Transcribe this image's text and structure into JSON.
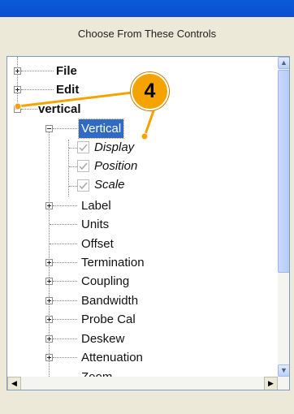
{
  "panel": {
    "title": "Choose From These Controls"
  },
  "tree": {
    "items": [
      {
        "label": "File",
        "expander": "plus",
        "style": "bold"
      },
      {
        "label": "Edit",
        "expander": "plus",
        "style": "bold"
      },
      {
        "label": "vertical",
        "expander": "minus",
        "style": "bold"
      },
      {
        "label": "Vertical",
        "expander": "minus",
        "selected": true
      },
      {
        "label": "Display",
        "checked": true,
        "style": "italic"
      },
      {
        "label": "Position",
        "checked": true,
        "style": "italic"
      },
      {
        "label": "Scale",
        "checked": true,
        "style": "italic"
      },
      {
        "label": "Label",
        "expander": "plus"
      },
      {
        "label": "Units"
      },
      {
        "label": "Offset"
      },
      {
        "label": "Termination",
        "expander": "plus"
      },
      {
        "label": "Coupling",
        "expander": "plus"
      },
      {
        "label": "Bandwidth",
        "expander": "plus"
      },
      {
        "label": "Probe Cal",
        "expander": "plus"
      },
      {
        "label": "Deskew",
        "expander": "plus"
      },
      {
        "label": "Attenuation",
        "expander": "plus"
      },
      {
        "label": "Zoom"
      }
    ]
  },
  "callout": {
    "number": "4",
    "color": "#f5a300"
  },
  "icons": {
    "scroll_up": "scroll-up-arrow-icon",
    "scroll_down": "scroll-down-arrow-icon",
    "scroll_left": "scroll-left-arrow-icon",
    "scroll_right": "scroll-right-arrow-icon"
  }
}
